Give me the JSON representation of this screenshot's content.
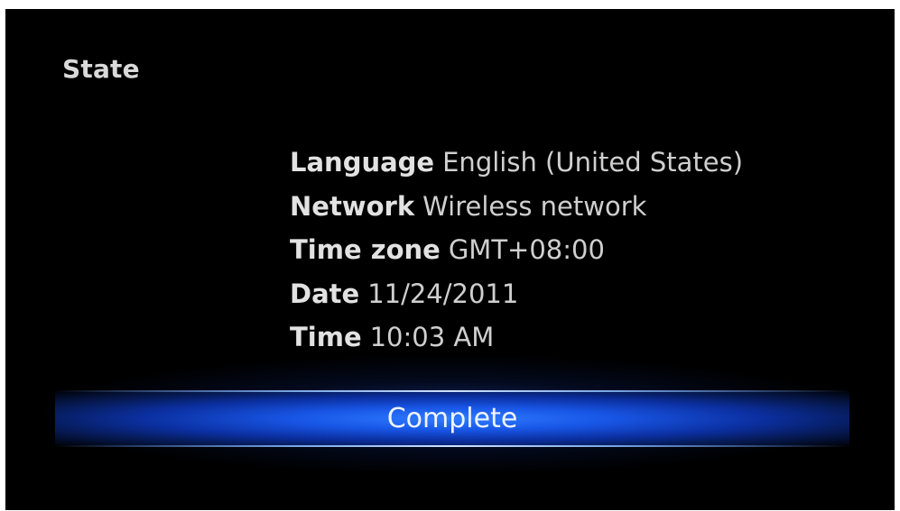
{
  "header": {
    "title": "State"
  },
  "info": {
    "rows": [
      {
        "label": "Language",
        "value": "English (United States)"
      },
      {
        "label": "Network",
        "value": "Wireless network"
      },
      {
        "label": "Time zone",
        "value": "GMT+08:00"
      },
      {
        "label": "Date",
        "value": "11/24/2011"
      },
      {
        "label": "Time",
        "value": "10:03 AM"
      }
    ]
  },
  "actions": {
    "complete_label": "Complete"
  },
  "colors": {
    "background": "#000000",
    "accent": "#1856e6",
    "text": "#d4d4d4"
  }
}
